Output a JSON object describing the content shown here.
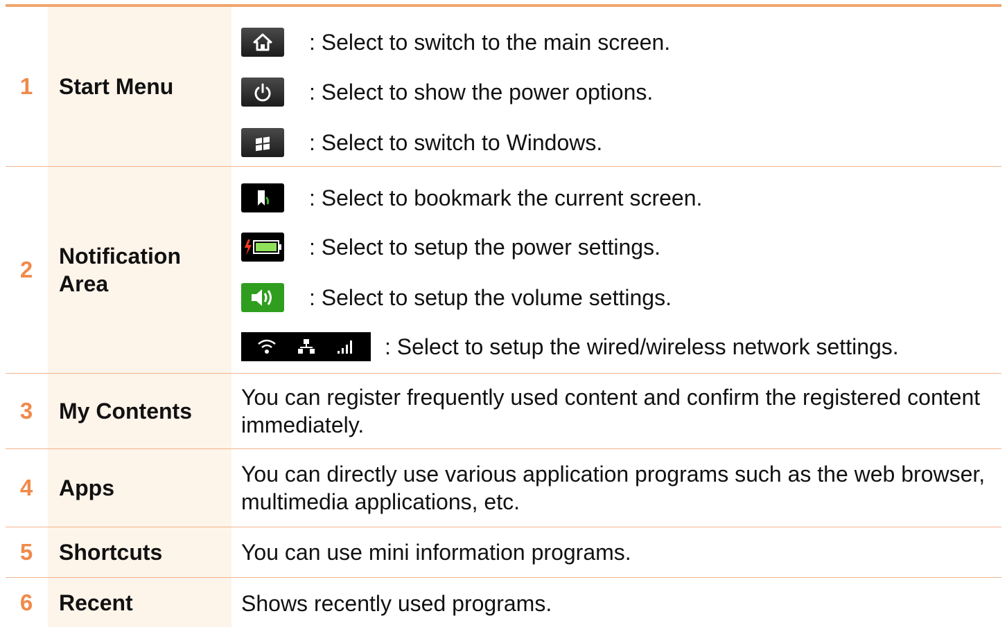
{
  "rows": [
    {
      "number": "1",
      "label": "Start Menu",
      "items": [
        {
          "icon": "home-icon",
          "text": ": Select to switch to the main screen."
        },
        {
          "icon": "power-icon",
          "text": ": Select to show the power options."
        },
        {
          "icon": "windows-icon",
          "text": ": Select to switch to Windows."
        }
      ]
    },
    {
      "number": "2",
      "label": "Notification Area",
      "items": [
        {
          "icon": "bookmark-icon",
          "text": ": Select to bookmark the current screen."
        },
        {
          "icon": "battery-icon",
          "text": ": Select to setup the power settings."
        },
        {
          "icon": "volume-icon",
          "text": ": Select to setup the volume settings."
        },
        {
          "icon": "network-icons",
          "text": ": Select to setup the wired/wireless network settings."
        }
      ]
    },
    {
      "number": "3",
      "label": "My Contents",
      "text": "You can register frequently used content and confirm the registered content immediately."
    },
    {
      "number": "4",
      "label": "Apps",
      "text": "You can directly use various application programs such as the web browser, multimedia applications, etc."
    },
    {
      "number": "5",
      "label": "Shortcuts",
      "text": "You can use mini information programs."
    },
    {
      "number": "6",
      "label": "Recent",
      "text": "Shows recently used programs."
    }
  ],
  "colors": {
    "accent_orange": "#f08a4b",
    "rule_orange": "#f2b389",
    "label_background": "#fdf4ea"
  }
}
